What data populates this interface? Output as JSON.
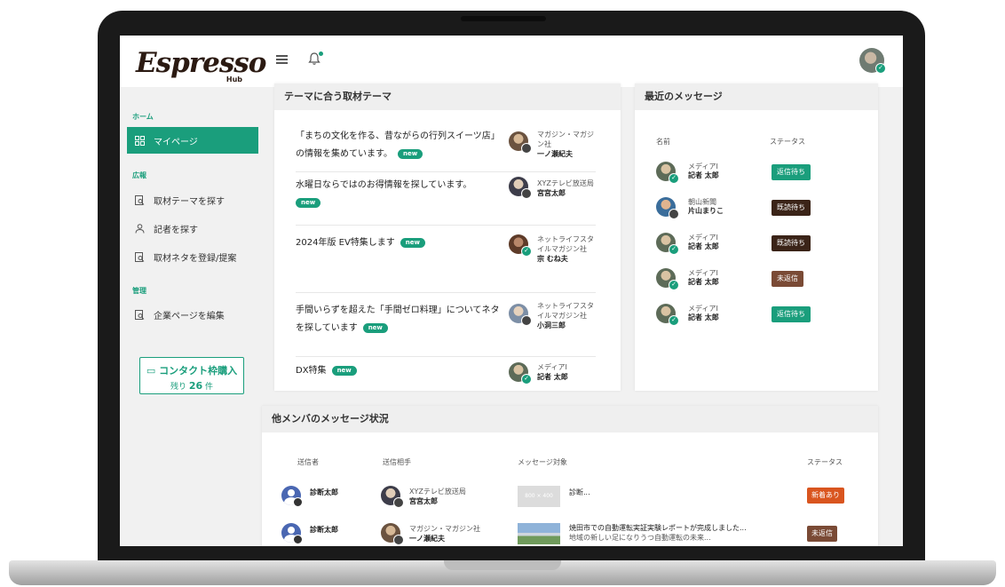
{
  "app": {
    "logo_main": "Espresso",
    "logo_sub": "Hub"
  },
  "header": {
    "menu_icon": "hamburger-icon",
    "bell_icon": "bell-icon"
  },
  "sidebar": {
    "sections": [
      {
        "label": "ホーム",
        "items": [
          {
            "label": "マイページ",
            "icon": "grid-icon",
            "active": true
          }
        ]
      },
      {
        "label": "広報",
        "items": [
          {
            "label": "取材テーマを探す",
            "icon": "search-doc-icon"
          },
          {
            "label": "記者を探す",
            "icon": "person-icon"
          },
          {
            "label": "取材ネタを登録/提案",
            "icon": "search-doc-icon"
          }
        ]
      },
      {
        "label": "管理",
        "items": [
          {
            "label": "企業ページを編集",
            "icon": "search-doc-icon"
          }
        ]
      }
    ],
    "contact": {
      "title": "コンタクト枠購入",
      "prefix": "残り",
      "count": "26",
      "suffix": "件"
    }
  },
  "themes": {
    "title": "テーマに合う取材テーマ",
    "new_label": "new",
    "rows": [
      {
        "text": "「まちの文化を作る、昔ながらの行列スイーツ店」の情報を集めています。",
        "who_lines": [
          "マガジン・マガジン社"
        ],
        "who_name": "一ノ瀬紀夫"
      },
      {
        "text": "水曜日ならではのお得情報を探しています。",
        "who_lines": [
          "XYZテレビ放送局"
        ],
        "who_name": "宮宮太郎"
      },
      {
        "text": "2024年版 EV特集します",
        "who_lines": [
          "ネットライフスタイルマガジン社"
        ],
        "who_name": "宗 むね夫"
      },
      {
        "text": "手間いらずを超えた「手間ゼロ料理」についてネタを探しています",
        "who_lines": [
          "ネットライフスタイルマガジン社"
        ],
        "who_name": "小洞三郎"
      },
      {
        "text": "DX特集",
        "who_lines": [
          "メディアI"
        ],
        "who_name": "記者 太郎"
      }
    ]
  },
  "recent": {
    "title": "最近のメッセージ",
    "col_name": "名前",
    "col_status": "ステータス",
    "rows": [
      {
        "org": "メディアI",
        "name": "記者 太郎",
        "status": "返信待ち",
        "status_color": "#1a9e7c"
      },
      {
        "org": "朝山新聞",
        "name": "片山まりこ",
        "status": "既読待ち",
        "status_color": "#3b2418"
      },
      {
        "org": "メディアI",
        "name": "記者 太郎",
        "status": "既読待ち",
        "status_color": "#3b2418"
      },
      {
        "org": "メディアI",
        "name": "記者 太郎",
        "status": "未返信",
        "status_color": "#7a4a35"
      },
      {
        "org": "メディアI",
        "name": "記者 太郎",
        "status": "返信待ち",
        "status_color": "#1a9e7c"
      }
    ]
  },
  "members": {
    "title": "他メンバのメッセージ状況",
    "col_sender": "送信者",
    "col_partner": "送信相手",
    "col_target": "メッセージ対象",
    "col_status": "ステータス",
    "rows": [
      {
        "sender": "診断太郎",
        "partner_org": "XYZテレビ放送局",
        "partner_name": "宮宮太郎",
        "thumb": "800 × 400",
        "target_title": "診断...",
        "target_sub": "",
        "status": "新着あり",
        "status_color": "#d9551f"
      },
      {
        "sender": "診断太郎",
        "partner_org": "マガジン・マガジン社",
        "partner_name": "一ノ瀬紀夫",
        "thumb": "",
        "target_title": "焼田市での自動運転実証実験レポートが完成しました...",
        "target_sub": "地域の新しい足になりうつ自動運転の未来...",
        "status": "未返信",
        "status_color": "#7a4a35"
      }
    ]
  }
}
